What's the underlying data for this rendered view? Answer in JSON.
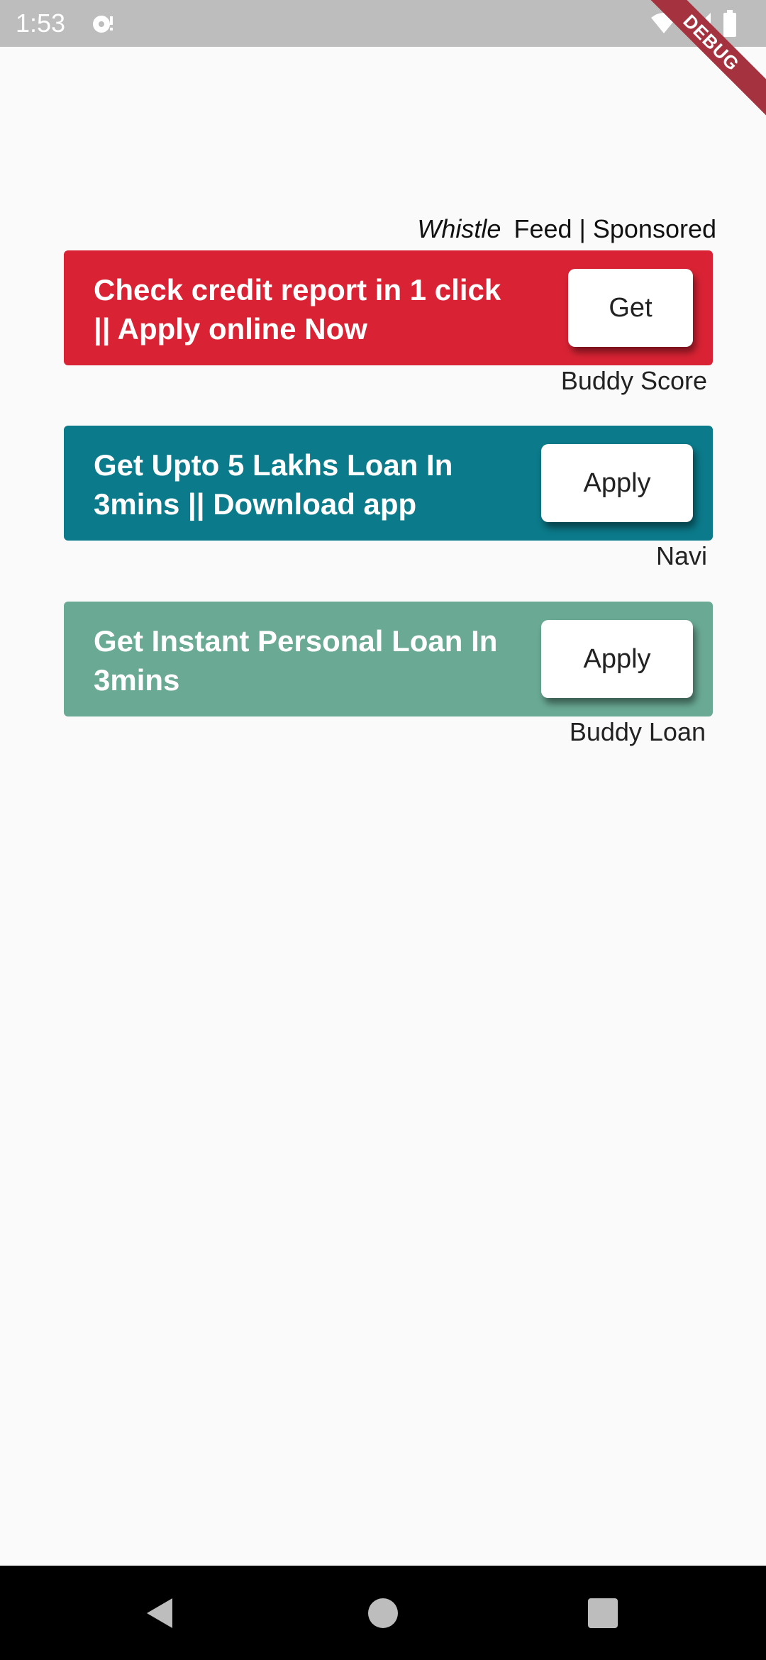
{
  "status_bar": {
    "time": "1:53",
    "icons": [
      "notification-icon",
      "wifi-icon",
      "signal-icon",
      "battery-icon"
    ],
    "debug_label": "DEBUG"
  },
  "header": {
    "brand": "Whistle",
    "label": "Feed | Sponsored"
  },
  "ads": [
    {
      "text": "Check credit report in 1 click || Apply online Now",
      "button": "Get",
      "sponsor": "Buddy Score",
      "color": "#d92334"
    },
    {
      "text": "Get Upto 5 Lakhs Loan In 3mins || Download app",
      "button": "Apply",
      "sponsor": "Navi",
      "color": "#0b7a8a"
    },
    {
      "text": "Get Instant Personal Loan In 3mins",
      "button": "Apply",
      "sponsor": "Buddy Loan",
      "color": "#6aaa94"
    }
  ],
  "nav_bar": {
    "buttons": [
      "back-icon",
      "home-icon",
      "recents-icon"
    ]
  }
}
